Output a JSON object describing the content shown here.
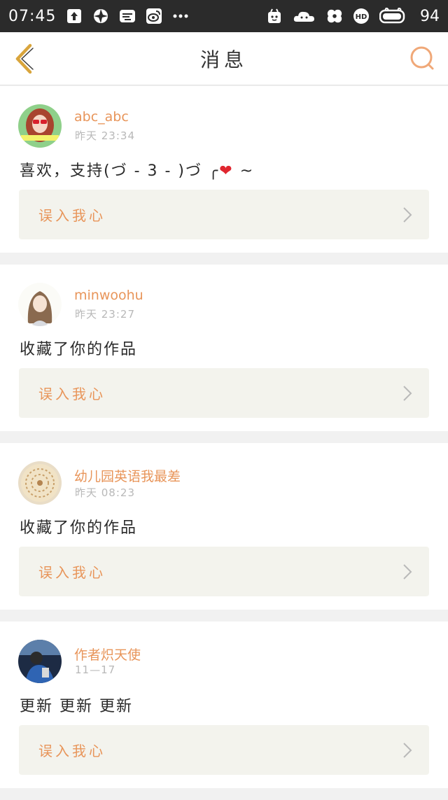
{
  "status_bar": {
    "time": "07:45",
    "battery": "94",
    "icons": [
      "upload-icon",
      "aperture-app-icon",
      "chat-app-icon",
      "weibo-icon",
      "more-dots-icon",
      "app-notification-icon",
      "cloud-app-icon",
      "clover-icon",
      "hd-icon",
      "battery-icon"
    ]
  },
  "header": {
    "title": "消息",
    "back_icon": "chevron-left-icon",
    "search_icon": "search-icon"
  },
  "colors": {
    "accent": "#e8955a",
    "header_icon": "#d9a53c",
    "search_icon": "#f0a878",
    "link_bg": "#f3f3ed"
  },
  "messages": [
    {
      "username": "abc_abc",
      "time": "昨天  23:34",
      "text": "喜欢，支持(づ - 3 - )づ ╭",
      "emoji": "❤",
      "text_suffix": " ~",
      "work_title": "误入我心"
    },
    {
      "username": "minwoohu",
      "time": "昨天  23:27",
      "text": "收藏了你的作品",
      "work_title": "误入我心"
    },
    {
      "username": "幼儿园英语我最差",
      "time": "昨天  08:23",
      "text": "收藏了你的作品",
      "work_title": "误入我心"
    },
    {
      "username": "作者炽天使",
      "time": "11—17",
      "text": "更新  更新  更新",
      "work_title": "误入我心"
    }
  ]
}
